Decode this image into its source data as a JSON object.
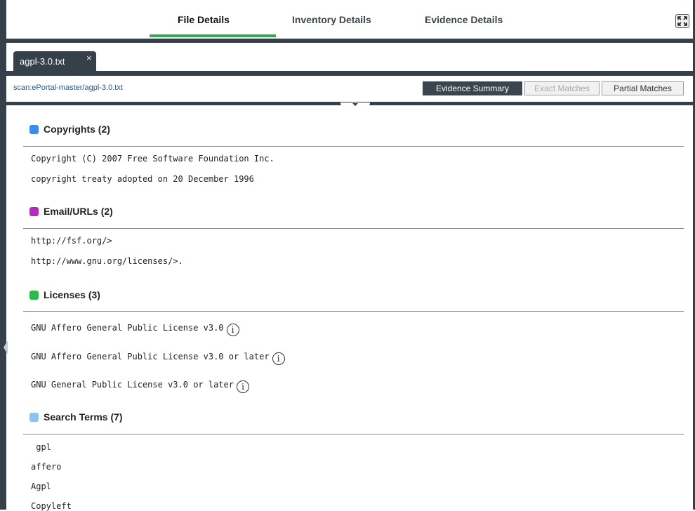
{
  "tabs": {
    "file_details": "File Details",
    "inventory_details": "Inventory Details",
    "evidence_details": "Evidence Details"
  },
  "file_tab": {
    "name": "agpl-3.0.txt",
    "close": "×"
  },
  "path": "scan:ePortal-master/agpl-3.0.txt",
  "views": {
    "evidence_summary": "Evidence Summary",
    "exact_matches": "Exact Matches",
    "partial_matches": "Partial Matches"
  },
  "colors": {
    "copyrights": "#3b8de8",
    "emails": "#b02fb8",
    "licenses": "#2fb84a",
    "search_terms": "#8fc1f0",
    "active_tab_underline": "#34a853",
    "frame": "#35404a"
  },
  "sections": {
    "copyrights": {
      "title": "Copyrights (2)",
      "items": [
        "Copyright (C) 2007 Free Software Foundation Inc.",
        "copyright treaty adopted on 20 December 1996"
      ]
    },
    "emails": {
      "title": "Email/URLs (2)",
      "items": [
        "http://fsf.org/>",
        "http://www.gnu.org/licenses/>."
      ]
    },
    "licenses": {
      "title": "Licenses (3)",
      "items": [
        "GNU Affero General Public License v3.0",
        "GNU Affero General Public License v3.0 or later",
        "GNU General Public License v3.0 or later"
      ],
      "info_icon": "i"
    },
    "search_terms": {
      "title": "Search Terms (7)",
      "items": [
        " gpl",
        "affero",
        "Agpl",
        "Copyleft"
      ]
    }
  }
}
